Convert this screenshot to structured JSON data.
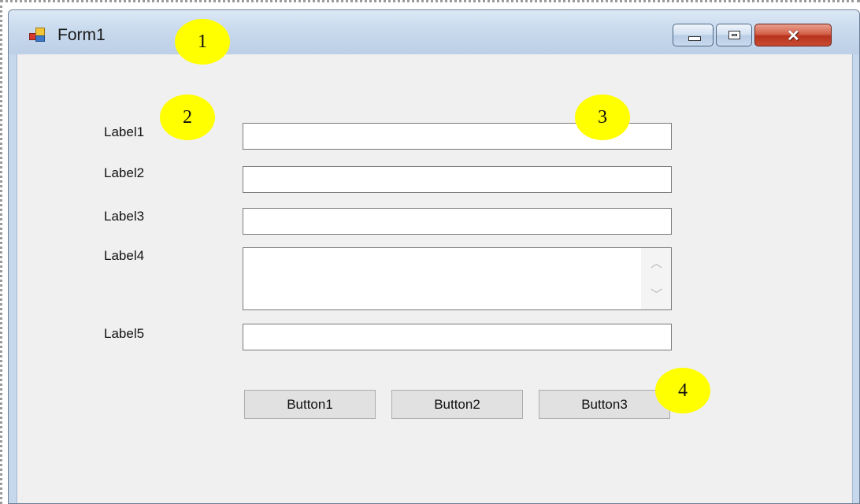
{
  "window": {
    "title": "Form1",
    "controls": {
      "minimize": "minimize",
      "maximize": "maximize",
      "close": "✕"
    }
  },
  "form": {
    "labels": [
      "Label1",
      "Label2",
      "Label3",
      "Label4",
      "Label5"
    ],
    "textboxes": [
      {
        "value": ""
      },
      {
        "value": ""
      },
      {
        "value": ""
      },
      {
        "value": "",
        "multiline": true
      },
      {
        "value": ""
      }
    ],
    "buttons": [
      "Button1",
      "Button2",
      "Button3"
    ]
  },
  "callouts": [
    "1",
    "2",
    "3",
    "4"
  ],
  "colors": {
    "callout": "#ffff00",
    "client_background": "#f0f0f0",
    "close_button": "#c84b32"
  }
}
